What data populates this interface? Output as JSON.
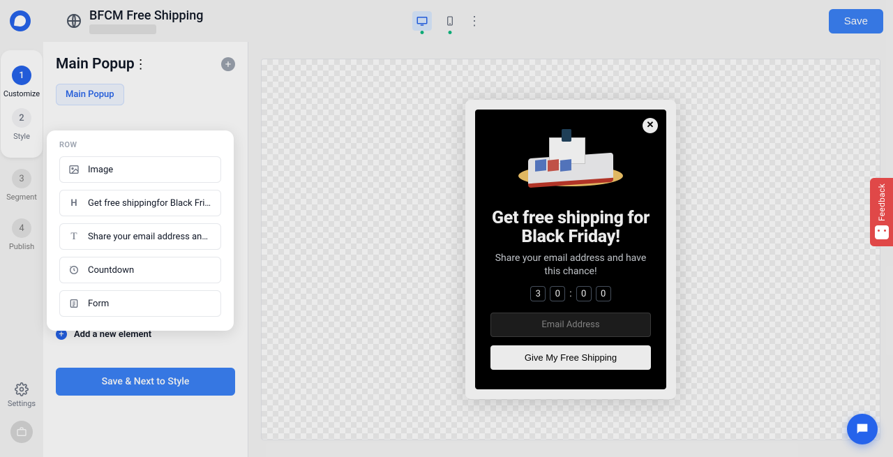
{
  "header": {
    "title": "BFCM Free Shipping",
    "save": "Save"
  },
  "steps": {
    "s1": {
      "num": "1",
      "label": "Customize"
    },
    "s2": {
      "num": "2",
      "label": "Style"
    },
    "s3": {
      "num": "3",
      "label": "Segment"
    },
    "s4": {
      "num": "4",
      "label": "Publish"
    }
  },
  "rail": {
    "settings": "Settings"
  },
  "panel": {
    "heading": "Main Popup",
    "chip": "Main Popup",
    "row_label": "ROW",
    "items": {
      "image": "Image",
      "heading": "Get free shippingfor Black Friday!",
      "text": "Share your email address and have th...",
      "countdown": "Countdown",
      "form": "Form"
    },
    "add": "Add a new element",
    "primary": "Save & Next to Style"
  },
  "popup": {
    "headline": "Get free shipping for Black Friday!",
    "sub": "Share your email address and have this chance!",
    "cd": [
      "3",
      "0",
      "0",
      "0"
    ],
    "placeholder": "Email Address",
    "cta": "Give My Free Shipping"
  },
  "feedback": "Feedback"
}
